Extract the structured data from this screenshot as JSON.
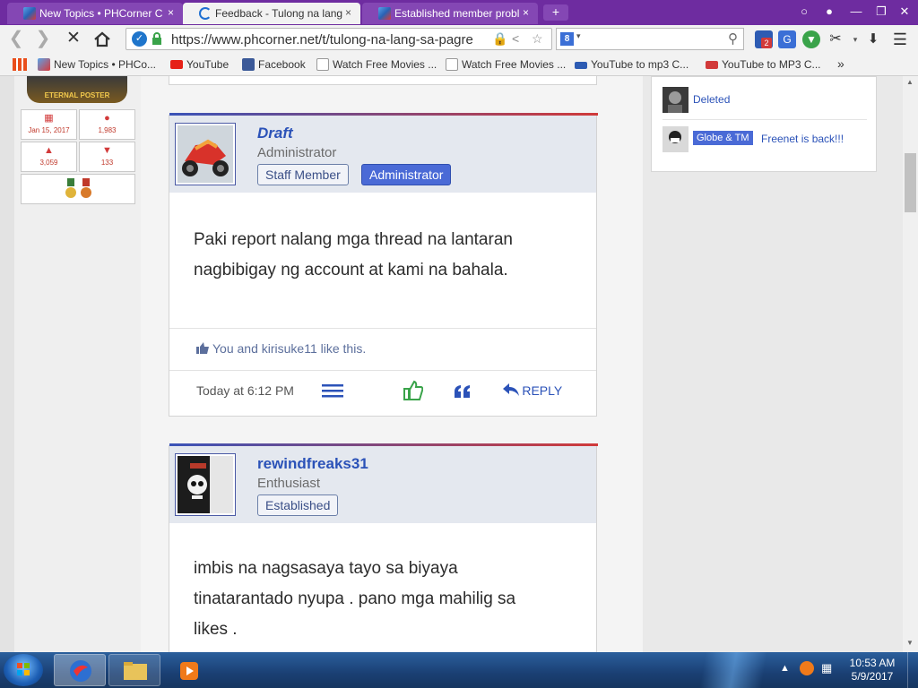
{
  "browser": {
    "tabs": [
      {
        "title": "New Topics • PHCorner C",
        "active": false
      },
      {
        "title": "Feedback - Tulong na lang",
        "active": true
      },
      {
        "title": "Established member probl",
        "active": false
      }
    ],
    "tab_close": "×",
    "new_tab": "+",
    "url": "https://www.phcorner.net/t/tulong-na-lang-sa-pagre",
    "search_engine_badge": "8",
    "search_placeholder": "",
    "ext_badge_count": "2",
    "bookmarks": [
      {
        "label": "New Topics • PHCo...",
        "icon": "phcorner-cube-icon"
      },
      {
        "label": "YouTube",
        "icon": "youtube-icon"
      },
      {
        "label": "Facebook",
        "icon": "facebook-icon"
      },
      {
        "label": "Watch Free Movies ...",
        "icon": "page-icon"
      },
      {
        "label": "Watch Free Movies ...",
        "icon": "page-icon"
      },
      {
        "label": "YouTube to mp3 C...",
        "icon": "mp3-icon"
      },
      {
        "label": "YouTube to MP3 C...",
        "icon": "converter-icon"
      }
    ],
    "more_bookmarks": "»"
  },
  "sidebar_left": {
    "banner_text": "ETERNAL POSTER",
    "stats": [
      {
        "icon": "calendar-icon",
        "value": "Jan 15, 2017"
      },
      {
        "icon": "speech-bubble-icon",
        "value": "1,983"
      },
      {
        "icon": "thumbs-up-icon",
        "value": "3,059"
      },
      {
        "icon": "trophy-icon",
        "value": "133"
      }
    ]
  },
  "posts": [
    {
      "username": "Draft",
      "title": "Administrator",
      "badges": [
        "Staff Member",
        "Administrator"
      ],
      "body_lines": [
        "Paki report nalang mga thread na lantaran",
        "nagbibigay ng account at kami na bahala."
      ],
      "likes_text": "You and kirisuke11 like this.",
      "time": "Today at 6:12 PM",
      "reply_label": "REPLY"
    },
    {
      "username": "rewindfreaks31",
      "title": "Enthusiast",
      "badges": [
        "Established"
      ],
      "body_lines": [
        "imbis na nagsasaya tayo sa biyaya",
        "tinatarantado nyupa . pano mga mahilig sa",
        "likes ."
      ]
    }
  ],
  "sidebar_right": {
    "items": [
      {
        "text": "Deleted"
      },
      {
        "tag": "Globe & TM",
        "text": "Freenet is back!!!"
      }
    ]
  },
  "taskbar": {
    "time": "10:53 AM",
    "date": "5/9/2017"
  },
  "colors": {
    "browser_frame": "#6e2ca0",
    "link_blue": "#2b52b8",
    "badge_blue": "#4a6ad6",
    "accent_red": "#d03a3a",
    "like_green": "#3aa34a"
  }
}
